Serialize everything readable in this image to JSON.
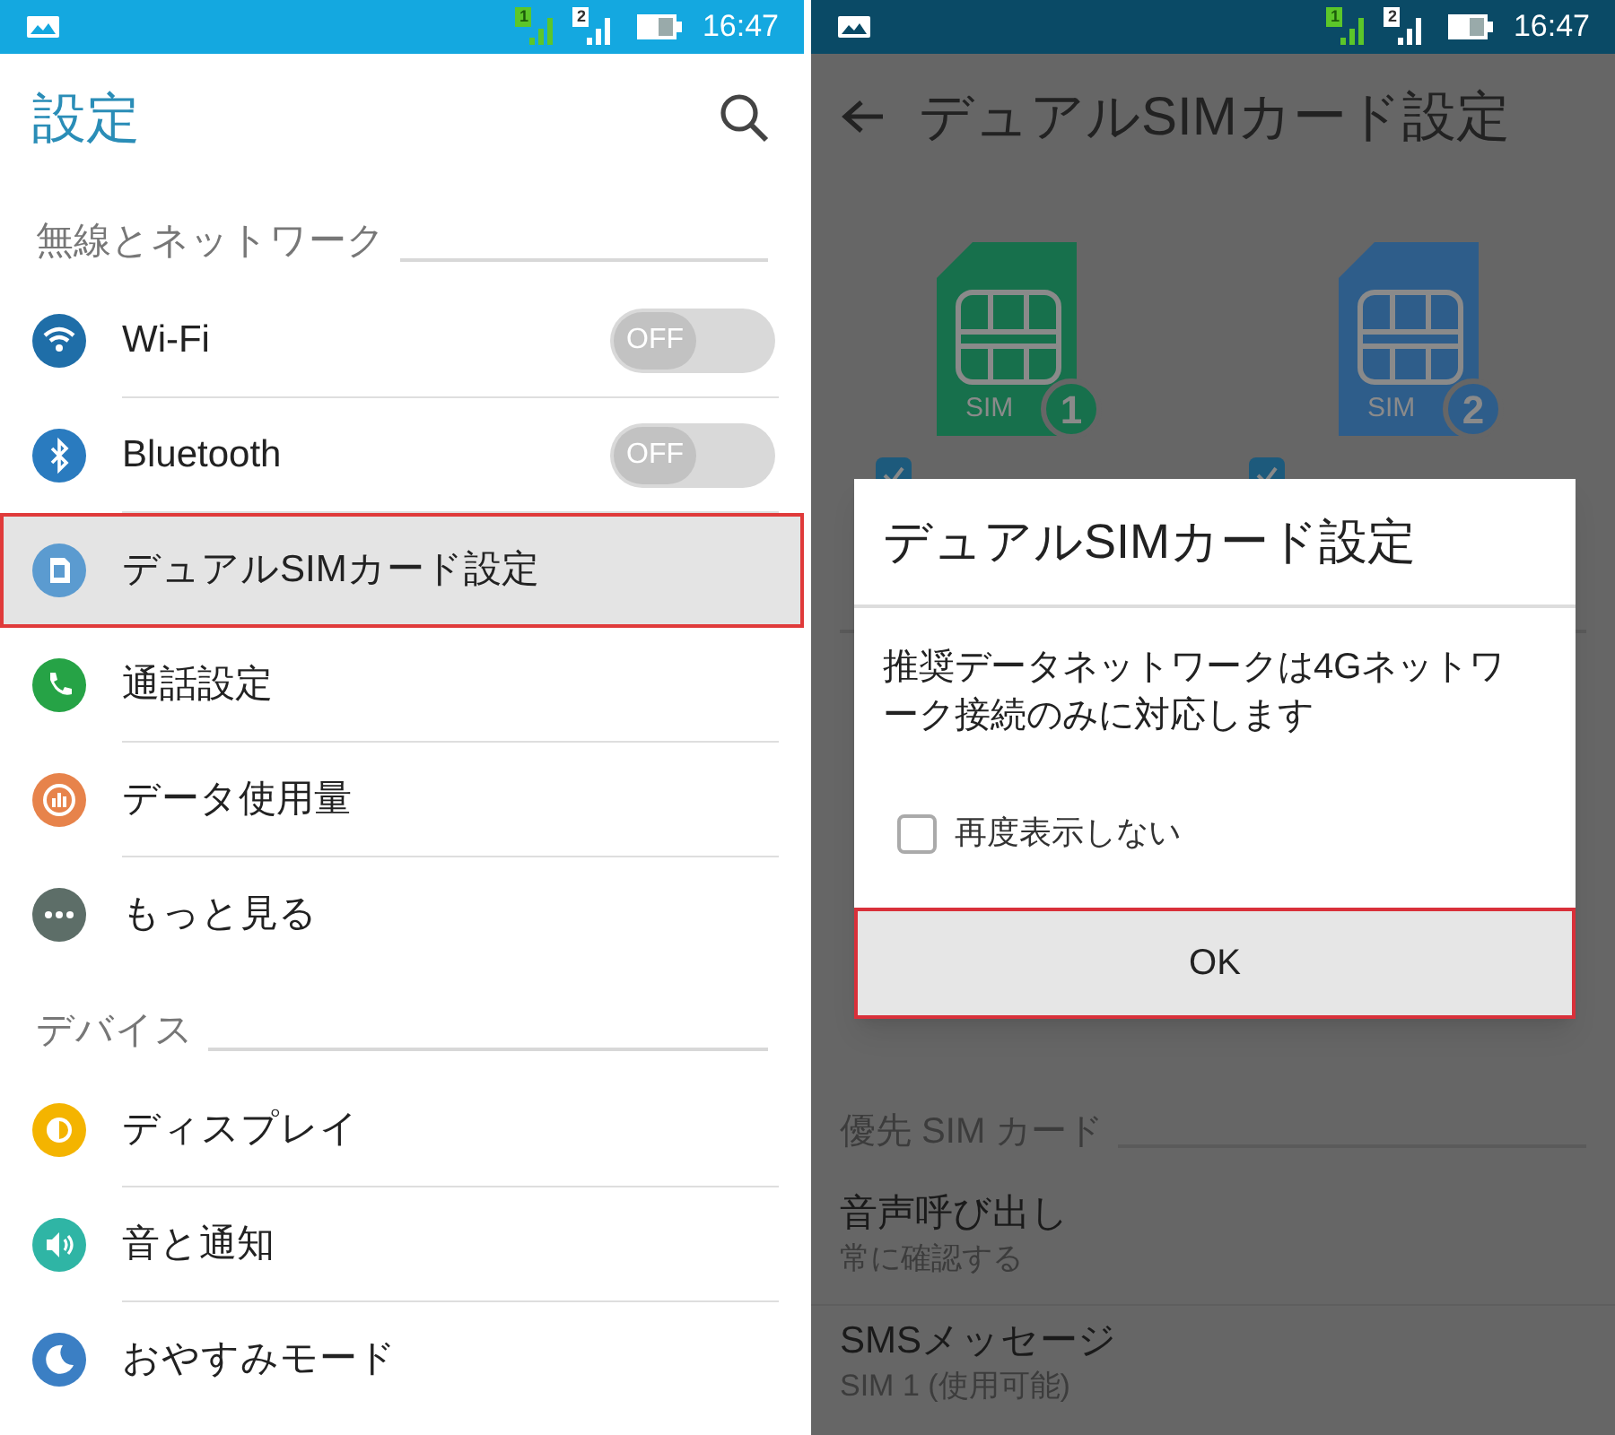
{
  "left_screen": {
    "status_bar": {
      "signal_labels": [
        "1",
        "2"
      ],
      "time": "16:47"
    },
    "title": "設定",
    "sections": [
      {
        "header": "無線とネットワーク",
        "items": [
          {
            "label": "Wi-Fi",
            "selected": false,
            "toggle": {
              "on": false,
              "label": "OFF"
            }
          },
          {
            "label": "Bluetooth",
            "selected": false,
            "toggle": {
              "on": false,
              "label": "OFF"
            }
          },
          {
            "label": "デュアルSIMカード設定",
            "selected": true
          },
          {
            "label": "通話設定",
            "selected": false
          },
          {
            "label": "データ使用量",
            "selected": false
          },
          {
            "label": "もっと見る",
            "selected": false
          }
        ]
      },
      {
        "header": "デバイス",
        "items": [
          {
            "label": "ディスプレイ",
            "selected": false
          },
          {
            "label": "音と通知",
            "selected": false
          },
          {
            "label": "おやすみモード",
            "selected": false
          }
        ]
      }
    ]
  },
  "right_screen": {
    "status_bar": {
      "signal_labels": [
        "1",
        "2"
      ],
      "time": "16:47"
    },
    "title": "デュアルSIMカード設定",
    "sim_cards": [
      {
        "label": "SIM",
        "badge": "1",
        "color": "#17704c",
        "checked": true
      },
      {
        "label": "SIM",
        "badge": "2",
        "color": "#2e5d8a",
        "checked": true
      }
    ],
    "preferred": {
      "header": "優先 SIM カード",
      "items": [
        {
          "title": "音声呼び出し",
          "subtitle": "常に確認する"
        },
        {
          "title": "SMSメッセージ",
          "subtitle": "SIM 1 (使用可能)"
        }
      ]
    },
    "dialog": {
      "title": "デュアルSIMカード設定",
      "message": "推奨データネットワークは4Gネットワーク接続のみに対応します",
      "checkbox": {
        "label": "再度表示しない",
        "checked": false
      },
      "button": {
        "label": "OK",
        "highlighted": true
      }
    }
  }
}
